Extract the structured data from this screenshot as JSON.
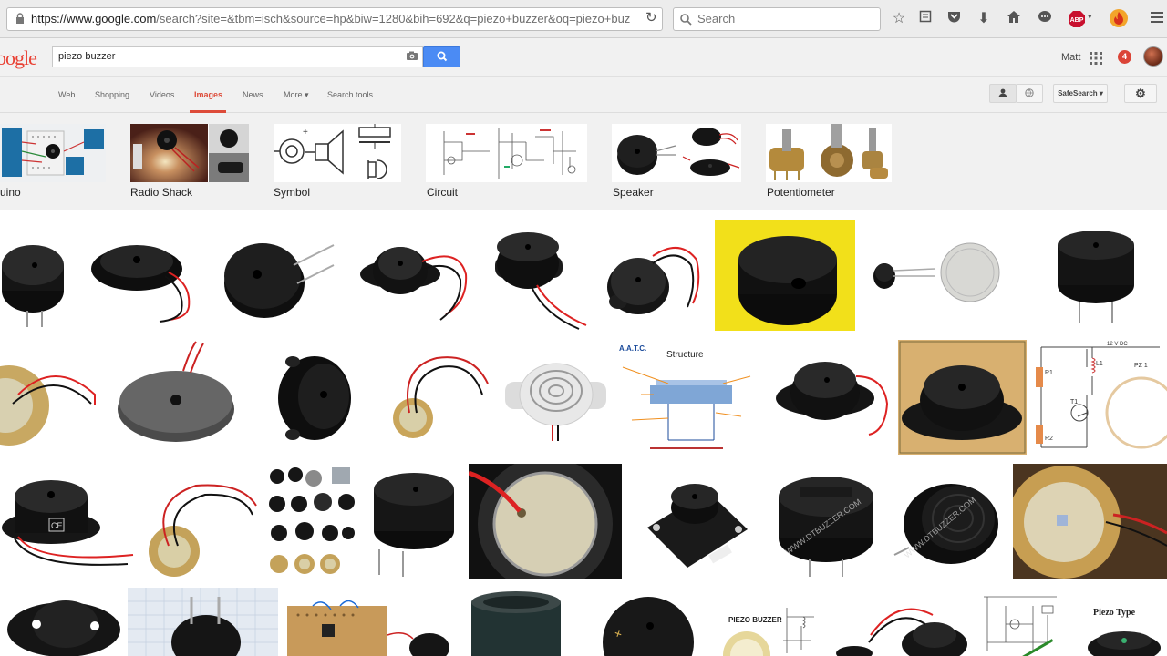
{
  "browser": {
    "url_host": "https://www.google.com",
    "url_path": "/search?site=&tbm=isch&source=hp&biw=1280&bih=692&q=piezo+buzzer&oq=piezo+buz",
    "search_placeholder": "Search",
    "abp_label": "ABP"
  },
  "google": {
    "logo": "oogle",
    "query": "piezo buzzer",
    "user": "Matt",
    "notifications": "4"
  },
  "tabs": {
    "web": "Web",
    "shopping": "Shopping",
    "videos": "Videos",
    "images": "Images",
    "news": "News",
    "more": "More ▾",
    "search_tools": "Search tools",
    "safesearch": "SafeSearch ▾"
  },
  "related": [
    {
      "label": "uino"
    },
    {
      "label": "Radio Shack"
    },
    {
      "label": "Symbol"
    },
    {
      "label": "Circuit"
    },
    {
      "label": "Speaker"
    },
    {
      "label": "Potentiometer"
    }
  ],
  "tile_text": {
    "aatc": "A.A.T.C.",
    "structure": "Structure",
    "twelve_v": "12 V DC",
    "piezo_buzzer": "PIEZO BUZZER",
    "piezo_type": "Piezo Type",
    "r1": "R1",
    "r2": "R2",
    "l1": "L1",
    "t1": "T1",
    "pz1": "PZ 1",
    "ce": "CE",
    "dtbuzzer": "WWW.DTBUZZER.COM",
    "dtbuzzer2": "WWW.DTBUZZER.COM"
  },
  "colors": {
    "accent_red": "#dd4b39",
    "search_blue": "#4b8bf4",
    "yellow_bg": "#f2e01a"
  }
}
